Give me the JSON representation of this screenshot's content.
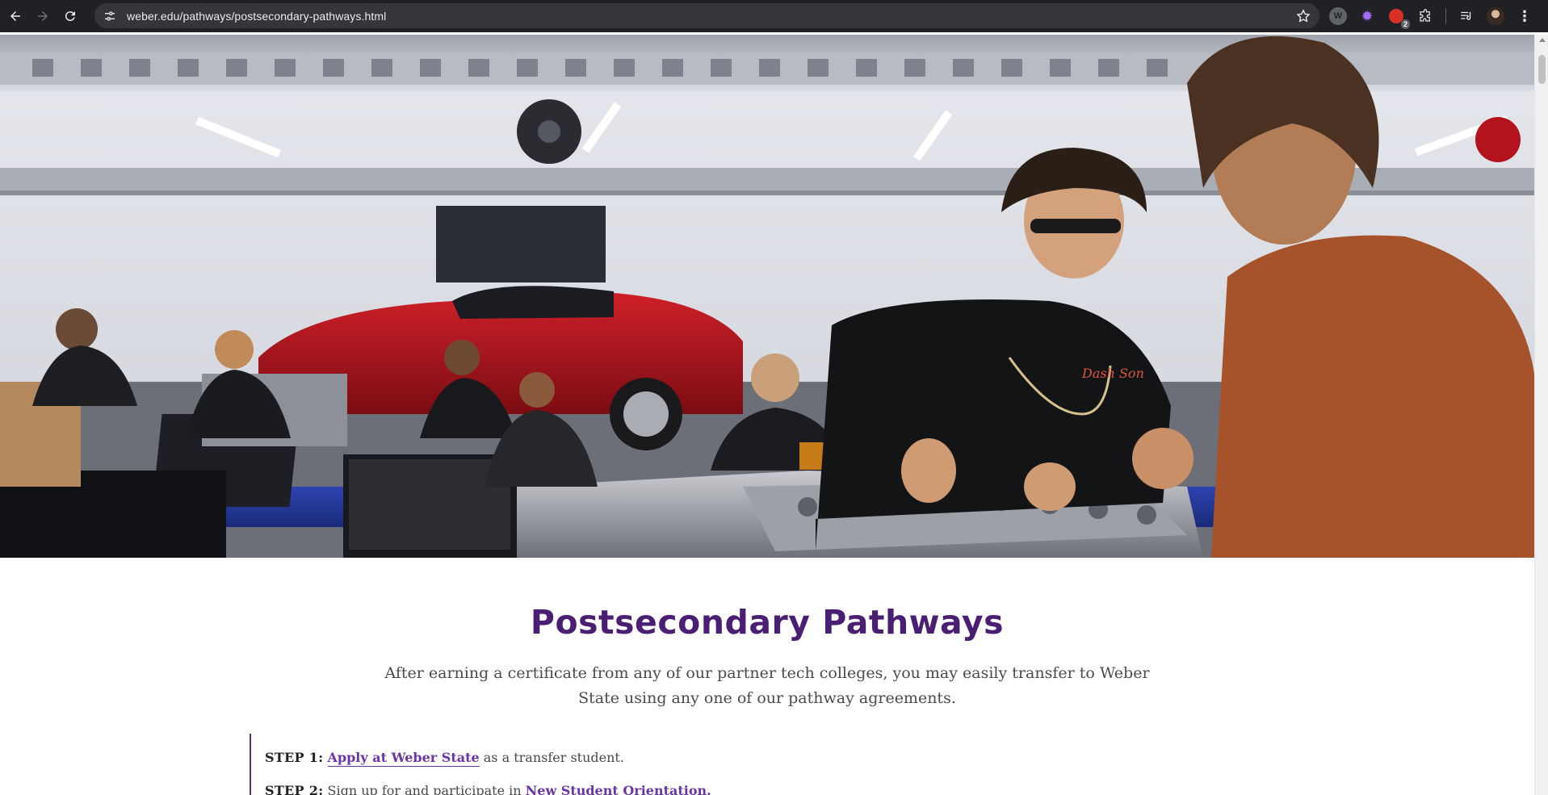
{
  "browser": {
    "url": "weber.edu/pathways/postsecondary-pathways.html",
    "extensions": [
      {
        "name": "w-extension-icon",
        "label": "W"
      },
      {
        "name": "gear-extension-icon",
        "label": ""
      },
      {
        "name": "notification-extension-icon",
        "label": "",
        "badge": "2"
      },
      {
        "name": "puzzle-extensions-icon",
        "label": ""
      }
    ]
  },
  "hero": {
    "description_icon": "photo"
  },
  "page": {
    "title": "Postsecondary Pathways",
    "intro": "After earning a certificate from any of our partner tech colleges, you may easily transfer to Weber State using any one of our pathway agreements.",
    "steps": [
      {
        "label": "STEP 1:",
        "link": "Apply at Weber State",
        "after": "as a transfer student."
      },
      {
        "label": "STEP 2:",
        "before": "Sign up for and participate in",
        "link": "New Student Orientation."
      }
    ]
  },
  "colors": {
    "accent": "#4a1e73",
    "link": "#6a35a6",
    "chrome_bg": "#202124",
    "omnibox_bg": "#35363a"
  }
}
